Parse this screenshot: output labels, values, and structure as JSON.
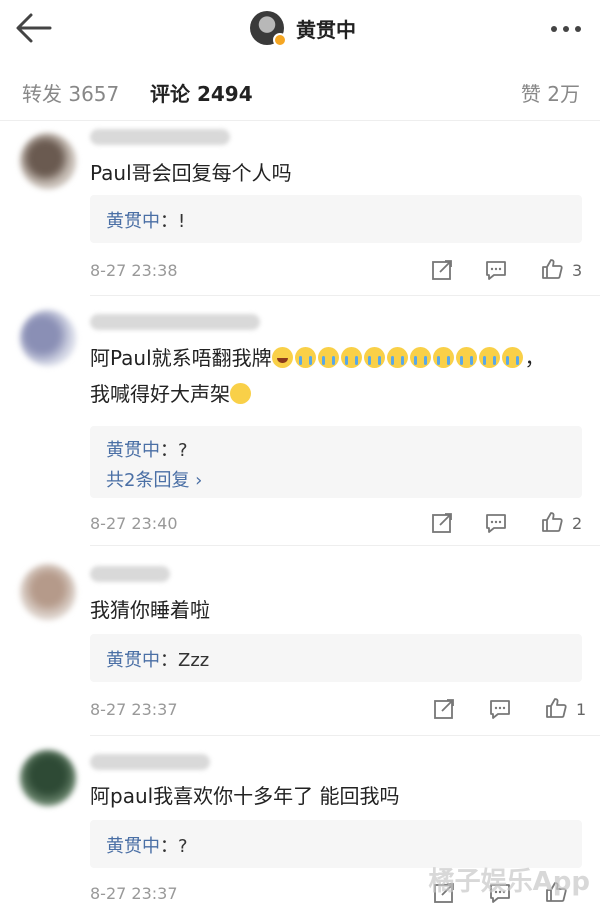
{
  "header": {
    "title": "黄贯中"
  },
  "tabs": {
    "repost": "转发 3657",
    "comments": "评论 2494",
    "likes": "赞 2万"
  },
  "comments": [
    {
      "text": "Paul哥会回复每个人吗",
      "reply": {
        "author": "黄贯中",
        "text": "：!"
      },
      "time": "8-27 23:38",
      "likes": "3"
    },
    {
      "text_line1": "阿Paul就系唔翻我牌",
      "text_line2": "我喊得好大声架",
      "comma": "，",
      "reply": {
        "author": "黄贯中",
        "text": "：?",
        "more": "共2条回复 ›"
      },
      "time": "8-27 23:40",
      "likes": "2"
    },
    {
      "text": "我猜你睡着啦",
      "reply": {
        "author": "黄贯中",
        "text": "：Zzz"
      },
      "time": "8-27 23:37",
      "likes": "1"
    },
    {
      "text": "阿paul我喜欢你十多年了 能回我吗",
      "reply": {
        "author": "黄贯中",
        "text": "：?"
      },
      "time": "8-27 23:37",
      "likes": ""
    }
  ],
  "watermark": "橘子娱乐App"
}
